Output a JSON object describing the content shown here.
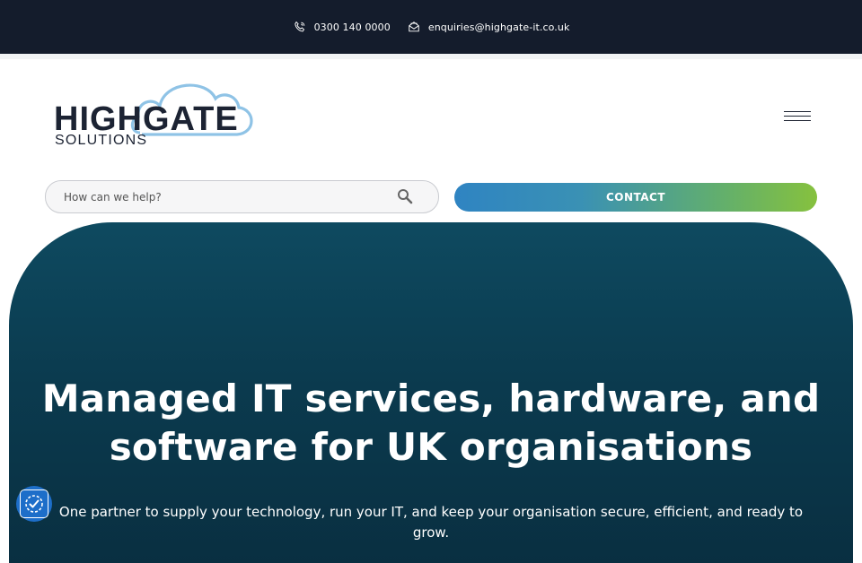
{
  "topbar": {
    "phone": "0300 140 0000",
    "email": "enquiries@highgate-it.co.uk",
    "phone_icon": "phone-icon",
    "email_icon": "email-icon"
  },
  "logo": {
    "line1": "HIGHGATE",
    "line2": "SOLUTIONS"
  },
  "search": {
    "placeholder": "How can we help?"
  },
  "contact_button": {
    "label": "CONTACT"
  },
  "hero": {
    "title_line1": "Managed IT services, hardware, and",
    "title_line2": "software for UK organisations",
    "subtitle": "One partner to supply your technology, run your IT, and keep your organisation secure, efficient, and ready to grow."
  },
  "colors": {
    "topbar_bg": "#141c2c",
    "hero_bg": "#0b3b4f",
    "brand_blue": "#2f84c2",
    "brand_green": "#86c13e",
    "logo_dark": "#1c2333",
    "logo_cloud": "#8fc3e6"
  }
}
